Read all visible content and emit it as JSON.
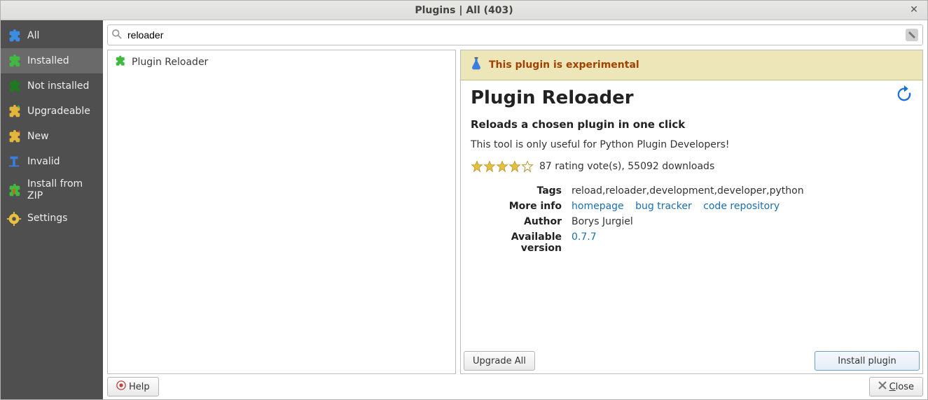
{
  "window": {
    "title": "Plugins | All (403)"
  },
  "sidebar": {
    "items": [
      {
        "label": "All"
      },
      {
        "label": "Installed"
      },
      {
        "label": "Not installed"
      },
      {
        "label": "Upgradeable"
      },
      {
        "label": "New"
      },
      {
        "label": "Invalid"
      },
      {
        "label": "Install from ZIP"
      },
      {
        "label": "Settings"
      }
    ]
  },
  "search": {
    "value": "reloader"
  },
  "results": {
    "items": [
      {
        "name": "Plugin Reloader"
      }
    ]
  },
  "detail": {
    "warning": "This plugin is experimental",
    "title": "Plugin Reloader",
    "subtitle": "Reloads a chosen plugin in one click",
    "description": "This tool is only useful for Python Plugin Developers!",
    "rating_text": "87 rating vote(s), 55092 downloads",
    "meta": {
      "tags_label": "Tags",
      "tags": "reload,reloader,development,developer,python",
      "moreinfo_label": "More info",
      "homepage": "homepage",
      "bugtracker": "bug tracker",
      "coderepo": "code repository",
      "author_label": "Author",
      "author": "Borys Jurgiel",
      "version_label": "Available version",
      "version": "0.7.7"
    }
  },
  "buttons": {
    "upgrade_all": "Upgrade All",
    "install_plugin": "Install plugin",
    "help": "Help",
    "close_prefix": "",
    "close_accel": "C",
    "close_suffix": "lose"
  }
}
